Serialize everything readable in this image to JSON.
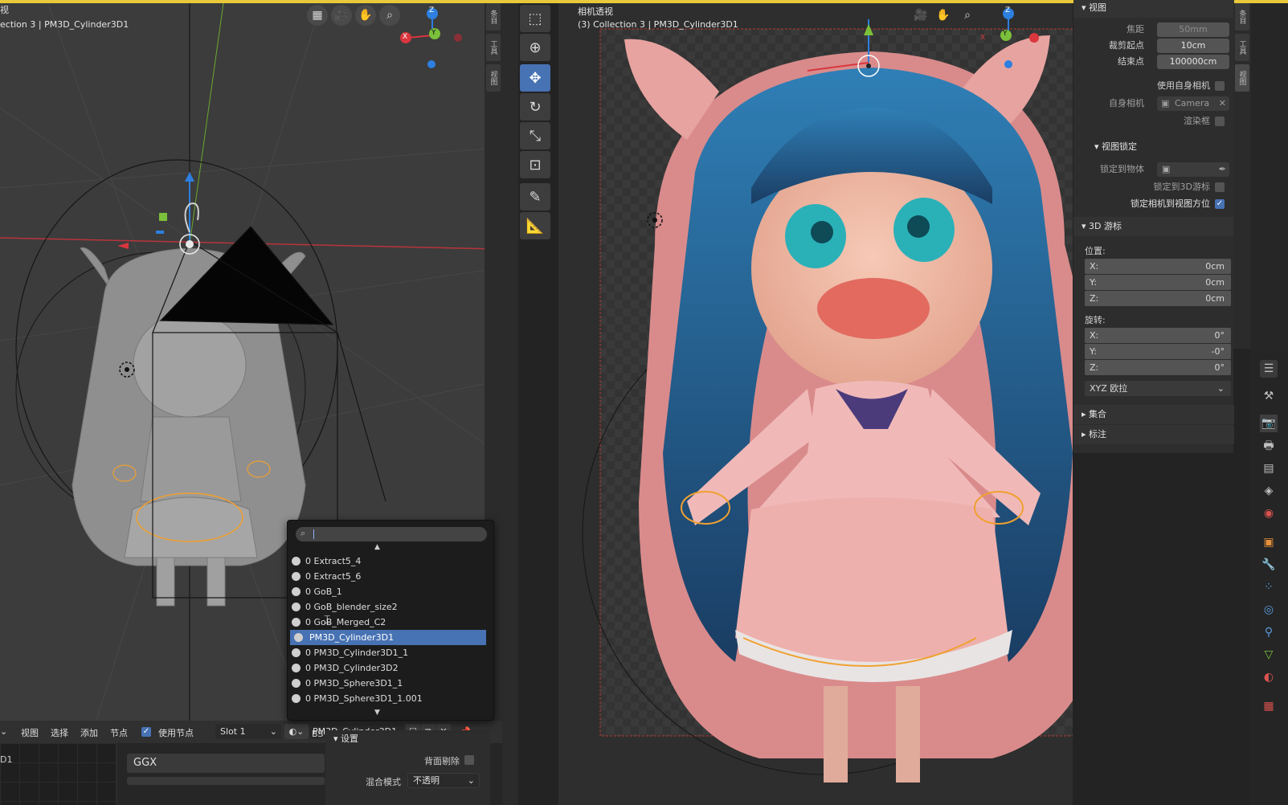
{
  "left_view": {
    "header": "ection 3 | PM3D_Cylinder3D1",
    "corner_glyph": "视"
  },
  "right_view": {
    "mode": "相机透视",
    "header": "(3) Collection 3 | PM3D_Cylinder3D1"
  },
  "side_tabs_left": [
    "条目",
    "工具",
    "视图"
  ],
  "side_tabs_right": [
    "条目",
    "工具",
    "视图"
  ],
  "gizmo": {
    "x": "X",
    "y": "Y",
    "z": "Z"
  },
  "toolbar": {
    "tools": [
      "select-box",
      "cursor",
      "move",
      "rotate",
      "scale",
      "transform",
      "annotate",
      "measure"
    ],
    "active": "move"
  },
  "npanel": {
    "view_section": "视图",
    "focal_label": "焦距",
    "focal_value": "50mm",
    "clip_start_label": "裁剪起点",
    "clip_start_value": "10cm",
    "clip_end_label": "结束点",
    "clip_end_value": "100000cm",
    "local_camera_label": "使用自身相机",
    "camera_label": "自身相机",
    "camera_value": "Camera",
    "render_region_label": "渲染框",
    "view_lock_section": "视图锁定",
    "lock_object_label": "锁定到物体",
    "lock_cursor_label": "锁定到3D游标",
    "lock_camera_label": "锁定相机到视图方位",
    "cursor_section": "3D 游标",
    "location_label": "位置:",
    "loc": [
      {
        "axis": "X:",
        "value": "0cm"
      },
      {
        "axis": "Y:",
        "value": "0cm"
      },
      {
        "axis": "Z:",
        "value": "0cm"
      }
    ],
    "rotation_label": "旋转:",
    "rot": [
      {
        "axis": "X:",
        "value": "0°"
      },
      {
        "axis": "Y:",
        "value": "-0°"
      },
      {
        "axis": "Z:",
        "value": "0°"
      }
    ],
    "rotation_mode": "XYZ 欧拉",
    "collection_section": "集合",
    "annotation_section": "标注"
  },
  "node_header": {
    "view": "视图",
    "select": "选择",
    "add": "添加",
    "node": "节点",
    "use_nodes": "使用节点",
    "slot": "Slot 1",
    "material_name": "PM3D_Cylinder3D1"
  },
  "node_area": {
    "left_label": "D1",
    "bs_label": "BS",
    "settings_label": "设置",
    "backface_label": "背面剔除",
    "blend_label": "混合模式",
    "blend_value": "不透明",
    "ggx_label": "GGX"
  },
  "dropdown": {
    "items": [
      "0 Extract5_4",
      "0 Extract5_6",
      "0 GoB_1",
      "0 GoB_blender_size2",
      "0 GoB_Merged_C2",
      "PM3D_Cylinder3D1",
      "0 PM3D_Cylinder3D1_1",
      "0 PM3D_Cylinder3D2",
      "0 PM3D_Sphere3D1_1",
      "0 PM3D_Sphere3D1_1.001"
    ],
    "selected_index": 5
  },
  "colors": {
    "accent": "#4772b3",
    "selection_outline": "#f0a030",
    "top_bar": "#e8c93a",
    "axis_x": "#d9363e",
    "axis_y": "#7bc03a",
    "axis_z": "#2d7fe0"
  }
}
